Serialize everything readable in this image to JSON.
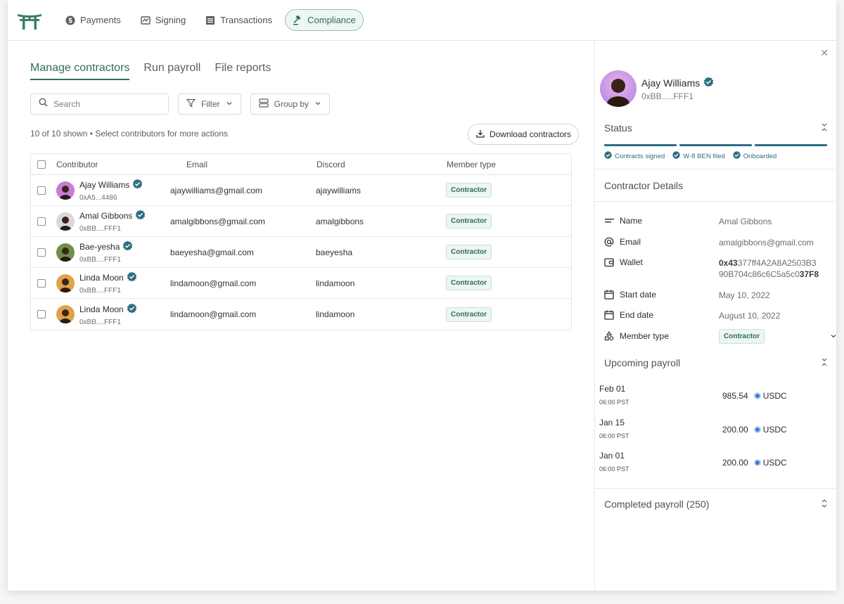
{
  "nav": {
    "items": [
      {
        "label": "Payments",
        "icon": "dollar-circle-icon",
        "active": false
      },
      {
        "label": "Signing",
        "icon": "signature-icon",
        "active": false
      },
      {
        "label": "Transactions",
        "icon": "list-icon",
        "active": false
      },
      {
        "label": "Compliance",
        "icon": "gavel-icon",
        "active": true
      }
    ]
  },
  "tabs": [
    "Manage contractors",
    "Run payroll",
    "File reports"
  ],
  "toolbar": {
    "search_placeholder": "Search",
    "filter_label": "Filter",
    "group_label": "Group by"
  },
  "summary": "10 of 10 shown • Select contributors for more actions",
  "download_label": "Download contractors",
  "table": {
    "headers": [
      "Contributor",
      "Email",
      "Discord",
      "Member type"
    ],
    "rows": [
      {
        "name": "Ajay Williams",
        "addr": "0xA5...4486",
        "email": "ajaywilliams@gmail.com",
        "discord": "ajaywilliams",
        "type": "Contractor",
        "avatar_color": "#c77dd8"
      },
      {
        "name": "Amal Gibbons",
        "addr": "0xBB....FFF1",
        "email": "amalgibbons@gmail.com",
        "discord": "amalgibbons",
        "type": "Contractor",
        "avatar_color": "#d9d9d9"
      },
      {
        "name": "Bae-yesha",
        "addr": "0xBB....FFF1",
        "email": "baeyesha@gmail.com",
        "discord": "baeyesha",
        "type": "Contractor",
        "avatar_color": "#6f8f4a"
      },
      {
        "name": "Linda Moon",
        "addr": "0xBB....FFF1",
        "email": "lindamoon@gmail.com",
        "discord": "lindamoon",
        "type": "Contractor",
        "avatar_color": "#e0a24a"
      },
      {
        "name": "Linda Moon",
        "addr": "0xBB....FFF1",
        "email": "lindamoon@gmail.com",
        "discord": "lindamoon",
        "type": "Contractor",
        "avatar_color": "#e0a24a"
      }
    ]
  },
  "panel": {
    "name": "Ajay Williams",
    "addr": "0xBB.....FFF1",
    "status_title": "Status",
    "status_steps": [
      "Contracts signed",
      "W-8 BEN filed",
      "Onboarded"
    ],
    "details_title": "Contractor Details",
    "details": {
      "name_label": "Name",
      "name_value": "Amal Gibbons",
      "email_label": "Email",
      "email_value": "amalgibbons@gmail.com",
      "wallet_label": "Wallet",
      "wallet_prefix": "0x43",
      "wallet_mid1": "377ff4A2A8A2503B3",
      "wallet_mid2": "90B704c86c6C5a5c0",
      "wallet_suffix": "37F8",
      "start_label": "Start date",
      "start_value": "May 10, 2022",
      "end_label": "End date",
      "end_value": "August 10, 2022",
      "type_label": "Member type",
      "type_value": "Contractor"
    },
    "upcoming_title": "Upcoming payroll",
    "upcoming": [
      {
        "date": "Feb 01",
        "time": "06:00 PST",
        "amount": "985.54",
        "currency": "USDC"
      },
      {
        "date": "Jan 15",
        "time": "06:00 PST",
        "amount": "200.00",
        "currency": "USDC"
      },
      {
        "date": "Jan 01",
        "time": "06:00 PST",
        "amount": "200.00",
        "currency": "USDC"
      }
    ],
    "completed_title": "Completed payroll (250)"
  },
  "colors": {
    "accent": "#2f6e55",
    "status": "#2d6d86",
    "verified": "#2f6e80"
  }
}
